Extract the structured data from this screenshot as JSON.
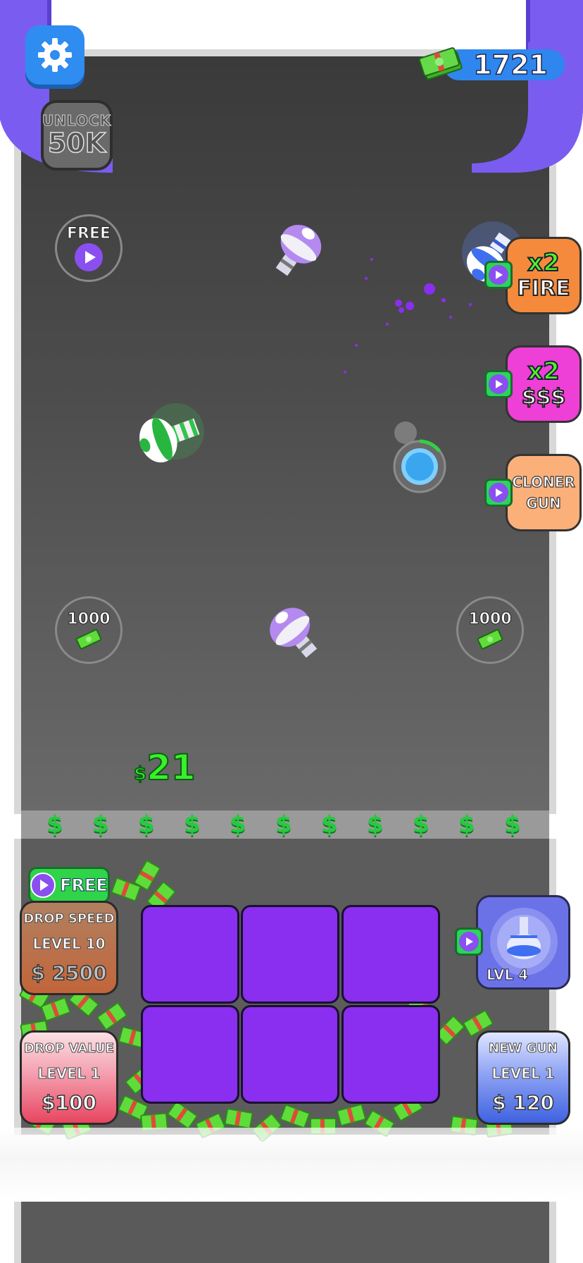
{
  "hud": {
    "money": "1721",
    "unlock_label": "UNLOCK",
    "unlock_amount": "50K"
  },
  "arena": {
    "free_button": "FREE",
    "cash_spot_left": "1000",
    "cash_spot_right": "1000",
    "floating_reward": "21",
    "floating_reward_symbol": "$"
  },
  "boosters": [
    {
      "top": "x2",
      "bottom": "FIRE",
      "color": "#f58a3c"
    },
    {
      "top": "x2",
      "bottom": "$$$",
      "color": "#ee3fd6"
    },
    {
      "top": "CLONER",
      "bottom": "GUN",
      "color": "#fbb07a"
    }
  ],
  "conveyor": {
    "symbol": "$"
  },
  "bottom_panel": {
    "free_label": "FREE",
    "drop_speed": {
      "name": "DROP SPEED",
      "level": "LEVEL 10",
      "price": "$ 2500"
    },
    "drop_value": {
      "name": "DROP VALUE",
      "level": "LEVEL 1",
      "price": "$100"
    },
    "new_gun": {
      "name": "NEW GUN",
      "level": "LEVEL 1",
      "price": "$ 120"
    },
    "gun_level_badge": "LVL 4"
  },
  "colors": {
    "frame_purple": "#7b5cf0",
    "slot_purple": "#8a2ef0",
    "cash_green": "#5fdc3a",
    "accent_blue": "#2f8cf0"
  }
}
